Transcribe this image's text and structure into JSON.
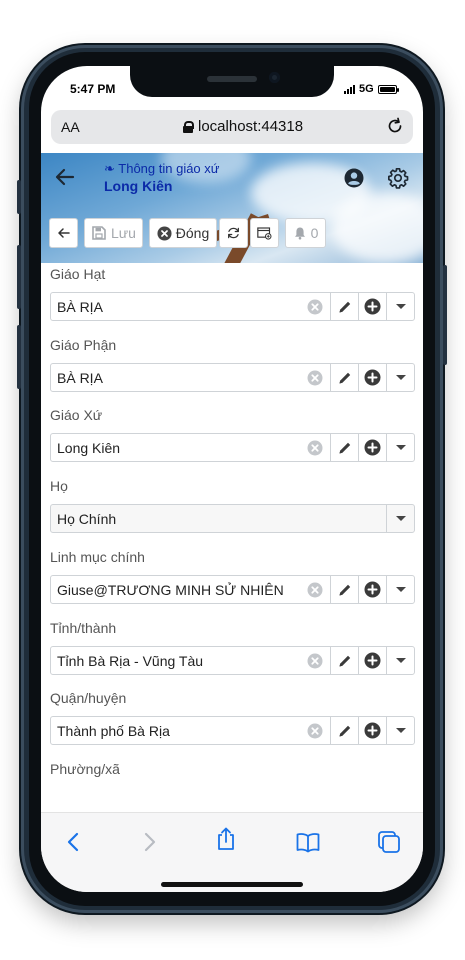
{
  "status": {
    "time": "5:47 PM",
    "network": "5G"
  },
  "browser": {
    "text_size_label": "AA",
    "url": "localhost:44318"
  },
  "header": {
    "subtitle": "❧ Thông tin giáo xứ",
    "title": "Long Kiên"
  },
  "toolbar": {
    "save_label": "Lưu",
    "close_label": "Đóng",
    "notification_count": "0"
  },
  "fields": [
    {
      "label": "Giáo Hạt",
      "value": "BÀ RỊA"
    },
    {
      "label": "Giáo Phận",
      "value": "BÀ RỊA"
    },
    {
      "label": "Giáo Xứ",
      "value": "Long Kiên"
    },
    {
      "label": "Họ",
      "value": "Họ Chính"
    },
    {
      "label": "Linh mục chính",
      "value": "Giuse@TRƯƠNG MINH SỬ NHIÊN"
    },
    {
      "label": "Tỉnh/thành",
      "value": "Tỉnh Bà Rịa - Vũng Tàu"
    },
    {
      "label": "Quận/huyện",
      "value": "Thành phố Bà Rịa"
    },
    {
      "label": "Phường/xã",
      "value": ""
    }
  ],
  "colors": {
    "header_text": "#0b2aa8",
    "safari_blue": "#1a73e8"
  },
  "icons": [
    "back-arrow-icon",
    "user-icon",
    "gear-icon",
    "save-icon",
    "close-circle-icon",
    "refresh-icon",
    "window-icon",
    "bell-icon",
    "clear-icon",
    "pencil-icon",
    "plus-circle-icon",
    "chevron-down-icon",
    "share-icon",
    "bookmarks-icon",
    "tabs-icon"
  ]
}
